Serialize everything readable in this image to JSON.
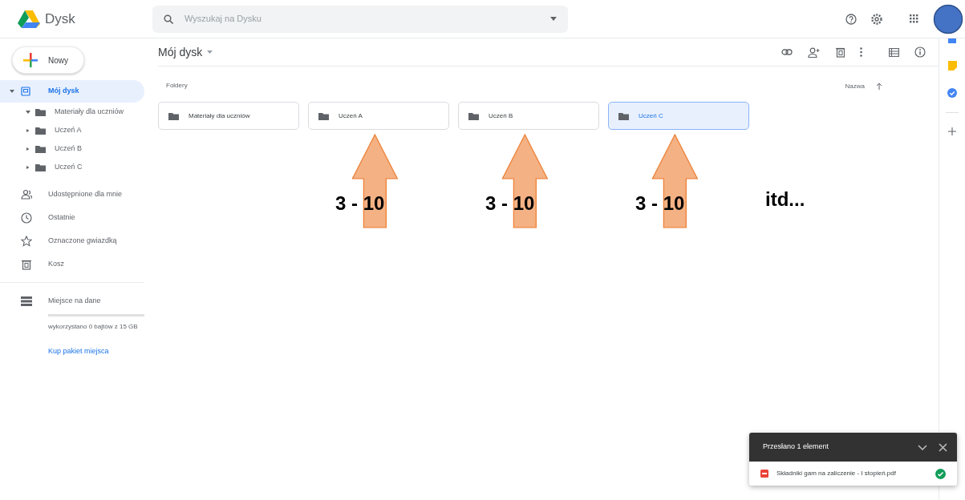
{
  "app": {
    "name": "Dysk"
  },
  "search": {
    "placeholder": "Wyszukaj na Dysku"
  },
  "new_button": {
    "label": "Nowy"
  },
  "sidebar": {
    "items": [
      {
        "kind": "drive",
        "label": "Mój dysk",
        "selected": true,
        "expanded": true,
        "children": [
          {
            "label": "Materiały dla uczniów",
            "expanded": true
          },
          {
            "label": "Uczeń A",
            "expanded": false
          },
          {
            "label": "Uczeń B",
            "expanded": false
          },
          {
            "label": "Uczeń C",
            "expanded": false
          }
        ]
      },
      {
        "kind": "shared",
        "label": "Udostępnione dla mnie",
        "selected": false
      },
      {
        "kind": "recent",
        "label": "Ostatnie",
        "selected": false
      },
      {
        "kind": "starred",
        "label": "Oznaczone gwiazdką",
        "selected": false
      },
      {
        "kind": "trash",
        "label": "Kosz",
        "selected": false
      }
    ]
  },
  "storage": {
    "label": "Miejsce na dane",
    "level": 0,
    "usage": "wykorzystano 0 bajtów z 15 GB",
    "link": "Kup pakiet miejsca"
  },
  "main": {
    "title": "Mój dysk",
    "section": "Foldery",
    "sort": "Nazwa",
    "folders": [
      {
        "name": "Materiały dla uczniów",
        "selected": false
      },
      {
        "name": "Uczeń A",
        "selected": false,
        "annotation": "3 - 10"
      },
      {
        "name": "Uczeń B",
        "selected": false,
        "annotation": "3 - 10"
      },
      {
        "name": "Uczeń C",
        "selected": true,
        "annotation": "3 - 10"
      }
    ],
    "trailing_note": "itd..."
  },
  "upload_toast": {
    "title": "Przesłano 1 element",
    "files": [
      {
        "name": "Składniki gam na zaliczenie - I stopień.pdf",
        "done": true
      }
    ]
  }
}
